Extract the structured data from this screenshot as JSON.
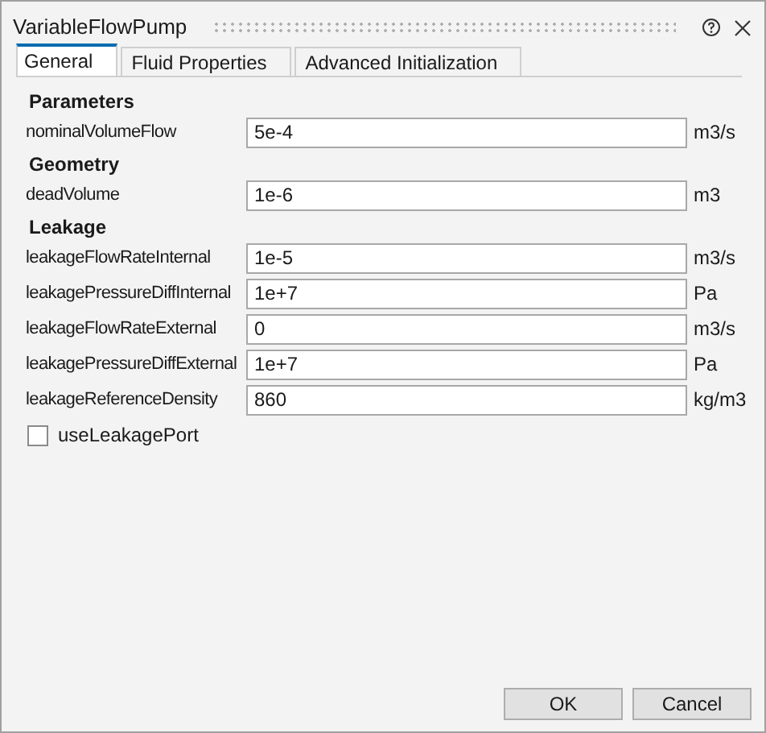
{
  "window": {
    "title": "VariableFlowPump"
  },
  "tabs": [
    {
      "label": "General",
      "selected": true
    },
    {
      "label": "Fluid Properties",
      "selected": false
    },
    {
      "label": "Advanced Initialization",
      "selected": false
    }
  ],
  "rows": [
    {
      "kind": "heading",
      "label": "Parameters"
    },
    {
      "kind": "field",
      "label": "nominalVolumeFlow",
      "value": "5e-4",
      "unit": "m3/s"
    },
    {
      "kind": "heading",
      "label": "Geometry"
    },
    {
      "kind": "field",
      "label": "deadVolume",
      "value": "1e-6",
      "unit": "m3"
    },
    {
      "kind": "heading",
      "label": "Leakage"
    },
    {
      "kind": "field",
      "label": "leakageFlowRateInternal",
      "value": "1e-5",
      "unit": "m3/s"
    },
    {
      "kind": "field",
      "label": "leakagePressureDiffInternal",
      "value": "1e+7",
      "unit": "Pa"
    },
    {
      "kind": "field",
      "label": "leakageFlowRateExternal",
      "value": "0",
      "unit": "m3/s"
    },
    {
      "kind": "field",
      "label": "leakagePressureDiffExternal",
      "value": "1e+7",
      "unit": "Pa"
    },
    {
      "kind": "field",
      "label": "leakageReferenceDensity",
      "value": "860",
      "unit": "kg/m3"
    },
    {
      "kind": "checkbox",
      "label": "useLeakagePort",
      "checked": false
    }
  ],
  "buttons": [
    "OK",
    "Cancel"
  ]
}
